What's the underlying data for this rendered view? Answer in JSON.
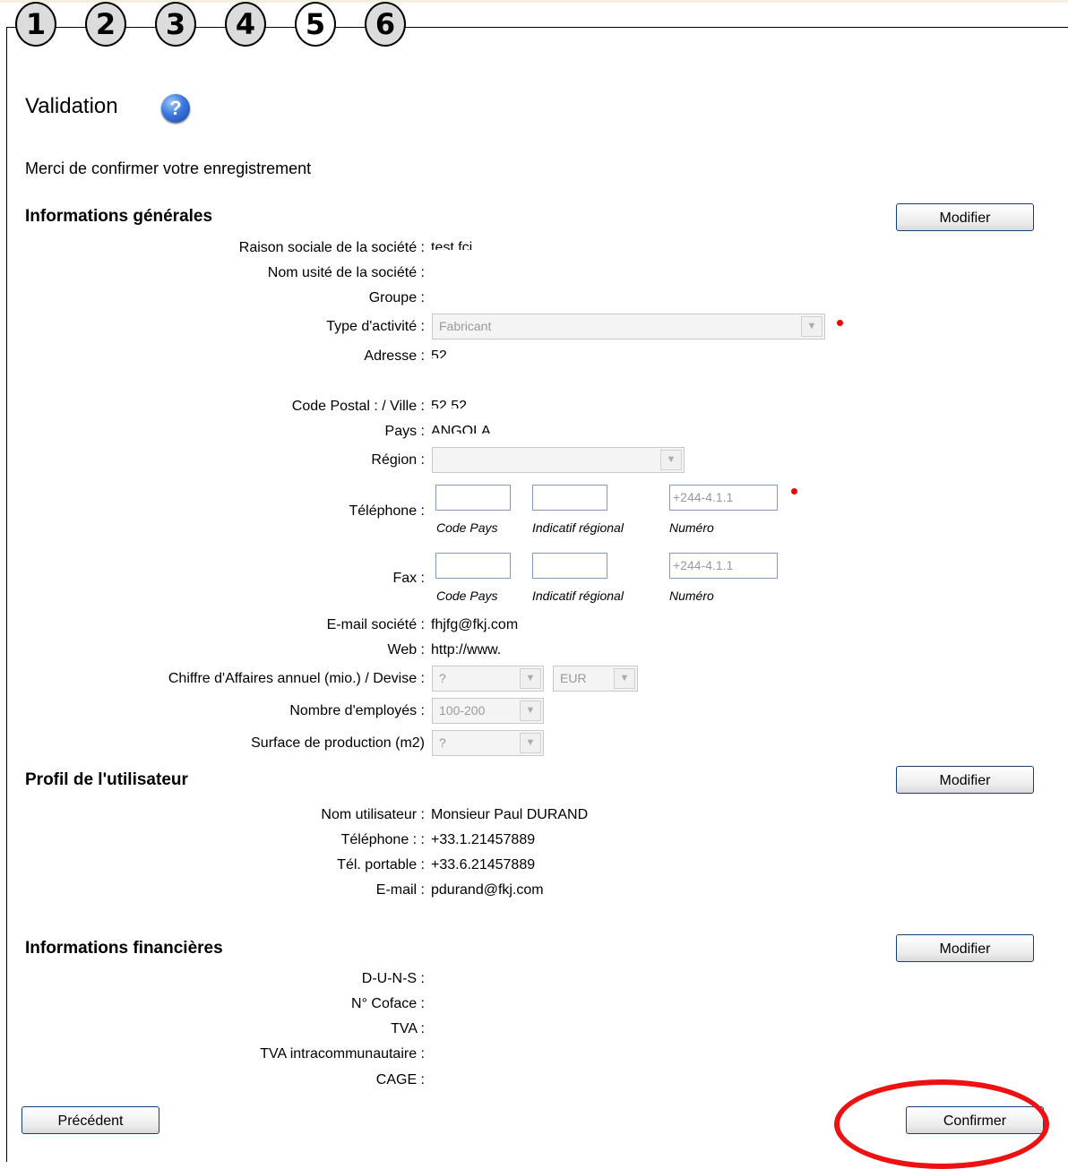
{
  "steps": [
    "1",
    "2",
    "3",
    "4",
    "5",
    "6"
  ],
  "title": "Validation",
  "intro": "Merci de confirmer votre enregistrement",
  "colors": {
    "required_dot": "#ee0000",
    "circle_mark": "#ee1111"
  },
  "icons": {
    "help": "question-icon"
  },
  "general": {
    "heading": "Informations générales",
    "modify": "Modifier",
    "raison_label": "Raison sociale de la société :",
    "raison_value": "test fcj",
    "nom_usite_label": "Nom usité de la société :",
    "groupe_label": "Groupe :",
    "type_label": "Type d'activité :",
    "type_value": "Fabricant",
    "adresse_label": "Adresse :",
    "adresse_value": "52",
    "cp_label": "Code Postal : / Ville :",
    "cp_value": "52 52",
    "pays_label": "Pays :",
    "pays_value": "ANGOLA",
    "region_label": "Région :",
    "tel_label": "Téléphone :",
    "tel_numero": "+244-4.1.1",
    "fax_label": "Fax :",
    "fax_numero": "+244-4.1.1",
    "code_pays": "Code Pays",
    "indicatif": "Indicatif régional",
    "numero": "Numéro",
    "email_label": "E-mail société :",
    "email_value": "fhjfg@fkj.com",
    "web_label": "Web :",
    "web_value": "http://www.",
    "ca_label": "Chiffre d'Affaires annuel (mio.) / Devise :",
    "ca_value": "?",
    "devise_value": "EUR",
    "employes_label": "Nombre d'employés :",
    "employes_value": "100-200",
    "surface_label": "Surface de production (m2)",
    "surface_value": "?"
  },
  "profil": {
    "heading": "Profil de l'utilisateur",
    "modify": "Modifier",
    "nom_label": "Nom utilisateur :",
    "nom_value": "Monsieur Paul DURAND",
    "tel_label": "Téléphone : :",
    "tel_value": "+33.1.21457889",
    "portable_label": "Tél. portable :",
    "portable_value": "+33.6.21457889",
    "email_label": "E-mail :",
    "email_value": "pdurand@fkj.com"
  },
  "financier": {
    "heading": "Informations financières",
    "modify": "Modifier",
    "duns_label": "D-U-N-S :",
    "coface_label": "N° Coface :",
    "tva_label": "TVA :",
    "tva_intra_label": "TVA intracommunautaire :",
    "cage_label": "CAGE :"
  },
  "buttons": {
    "previous": "Précédent",
    "confirm": "Confirmer"
  }
}
